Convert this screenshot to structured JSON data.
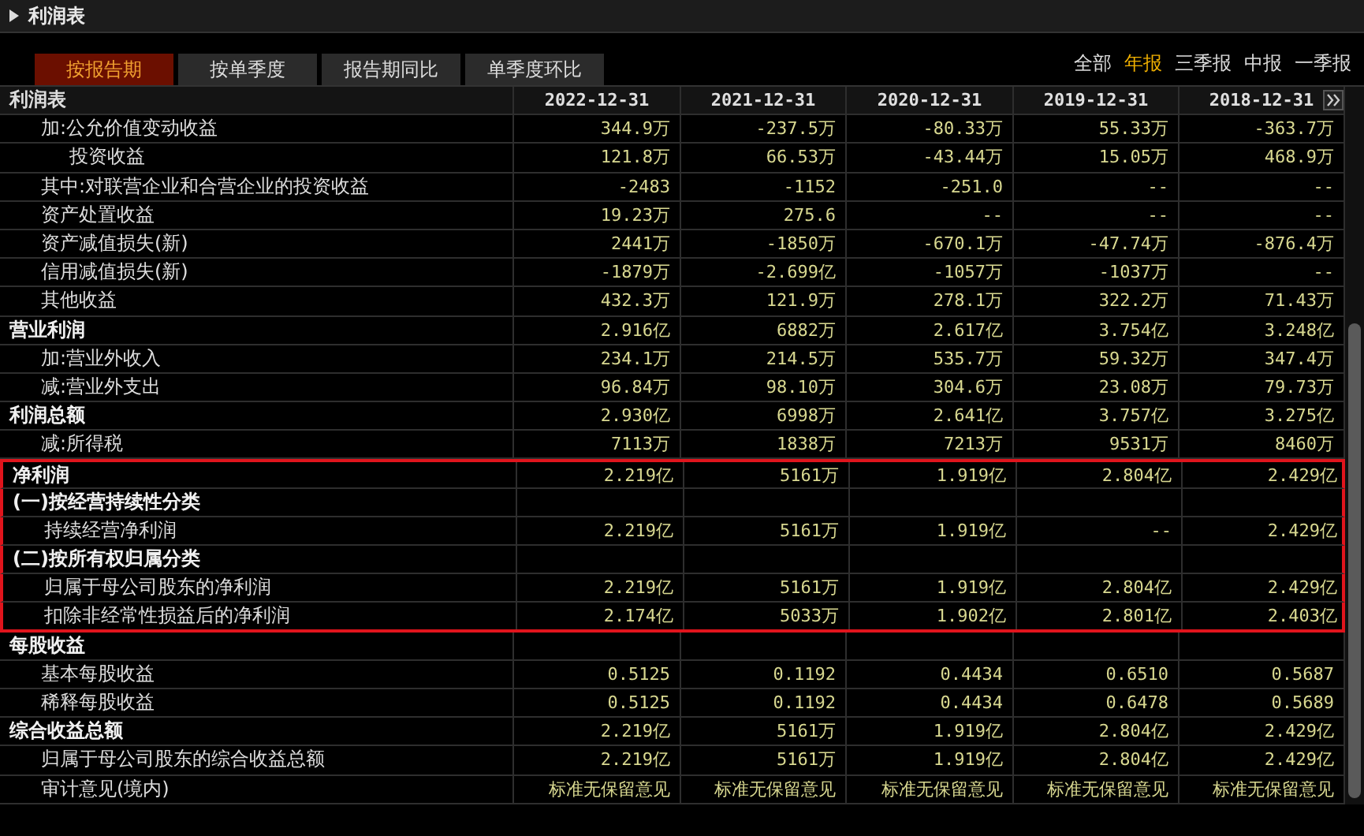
{
  "panel": {
    "title": "利润表"
  },
  "tabs": [
    {
      "label": "按报告期",
      "selected": true
    },
    {
      "label": "按单季度",
      "selected": false
    },
    {
      "label": "报告期同比",
      "selected": false
    },
    {
      "label": "单季度环比",
      "selected": false
    }
  ],
  "period_filters": [
    {
      "label": "全部",
      "selected": false
    },
    {
      "label": "年报",
      "selected": true
    },
    {
      "label": "三季报",
      "selected": false
    },
    {
      "label": "中报",
      "selected": false
    },
    {
      "label": "一季报",
      "selected": false
    }
  ],
  "table": {
    "columns": [
      "利润表",
      "2022-12-31",
      "2021-12-31",
      "2020-12-31",
      "2019-12-31",
      "2018-12-31"
    ],
    "rows": [
      {
        "label": "加:公允价值变动收益",
        "kind": "item",
        "highlighted": false,
        "values": [
          "344.9万",
          "-237.5万",
          "-80.33万",
          "55.33万",
          "-363.7万"
        ]
      },
      {
        "label": "投资收益",
        "kind": "subitem",
        "highlighted": false,
        "values": [
          "121.8万",
          "66.53万",
          "-43.44万",
          "15.05万",
          "468.9万"
        ]
      },
      {
        "label": "其中:对联营企业和合营企业的投资收益",
        "kind": "item",
        "highlighted": false,
        "values": [
          "-2483",
          "-1152",
          "-251.0",
          "--",
          "--"
        ]
      },
      {
        "label": "资产处置收益",
        "kind": "item",
        "highlighted": false,
        "values": [
          "19.23万",
          "275.6",
          "--",
          "--",
          "--"
        ]
      },
      {
        "label": "资产减值损失(新)",
        "kind": "item",
        "highlighted": false,
        "values": [
          "2441万",
          "-1850万",
          "-670.1万",
          "-47.74万",
          "-876.4万"
        ]
      },
      {
        "label": "信用减值损失(新)",
        "kind": "item",
        "highlighted": false,
        "values": [
          "-1879万",
          "-2.699亿",
          "-1057万",
          "-1037万",
          "--"
        ]
      },
      {
        "label": "其他收益",
        "kind": "item",
        "highlighted": false,
        "values": [
          "432.3万",
          "121.9万",
          "278.1万",
          "322.2万",
          "71.43万"
        ]
      },
      {
        "label": "营业利润",
        "kind": "section",
        "highlighted": false,
        "values": [
          "2.916亿",
          "6882万",
          "2.617亿",
          "3.754亿",
          "3.248亿"
        ]
      },
      {
        "label": "加:营业外收入",
        "kind": "item",
        "highlighted": false,
        "values": [
          "234.1万",
          "214.5万",
          "535.7万",
          "59.32万",
          "347.4万"
        ]
      },
      {
        "label": "减:营业外支出",
        "kind": "item",
        "highlighted": false,
        "values": [
          "96.84万",
          "98.10万",
          "304.6万",
          "23.08万",
          "79.73万"
        ]
      },
      {
        "label": "利润总额",
        "kind": "section",
        "highlighted": false,
        "values": [
          "2.930亿",
          "6998万",
          "2.641亿",
          "3.757亿",
          "3.275亿"
        ]
      },
      {
        "label": "减:所得税",
        "kind": "item",
        "highlighted": false,
        "values": [
          "7113万",
          "1838万",
          "7213万",
          "9531万",
          "8460万"
        ]
      },
      {
        "label": "净利润",
        "kind": "section",
        "highlighted": true,
        "values": [
          "2.219亿",
          "5161万",
          "1.919亿",
          "2.804亿",
          "2.429亿"
        ]
      },
      {
        "label": "(一)按经营持续性分类",
        "kind": "section",
        "highlighted": true,
        "values": []
      },
      {
        "label": "持续经营净利润",
        "kind": "item",
        "highlighted": true,
        "values": [
          "2.219亿",
          "5161万",
          "1.919亿",
          "--",
          "2.429亿"
        ]
      },
      {
        "label": "(二)按所有权归属分类",
        "kind": "section",
        "highlighted": true,
        "values": []
      },
      {
        "label": "归属于母公司股东的净利润",
        "kind": "item",
        "highlighted": true,
        "values": [
          "2.219亿",
          "5161万",
          "1.919亿",
          "2.804亿",
          "2.429亿"
        ]
      },
      {
        "label": "扣除非经常性损益后的净利润",
        "kind": "item",
        "highlighted": true,
        "values": [
          "2.174亿",
          "5033万",
          "1.902亿",
          "2.801亿",
          "2.403亿"
        ]
      },
      {
        "label": "每股收益",
        "kind": "section",
        "highlighted": false,
        "values": []
      },
      {
        "label": "基本每股收益",
        "kind": "item",
        "highlighted": false,
        "values": [
          "0.5125",
          "0.1192",
          "0.4434",
          "0.6510",
          "0.5687"
        ]
      },
      {
        "label": "稀释每股收益",
        "kind": "item",
        "highlighted": false,
        "values": [
          "0.5125",
          "0.1192",
          "0.4434",
          "0.6478",
          "0.5689"
        ]
      },
      {
        "label": "综合收益总额",
        "kind": "section",
        "highlighted": false,
        "values": [
          "2.219亿",
          "5161万",
          "1.919亿",
          "2.804亿",
          "2.429亿"
        ]
      },
      {
        "label": "归属于母公司股东的综合收益总额",
        "kind": "item",
        "highlighted": false,
        "values": [
          "2.219亿",
          "5161万",
          "1.919亿",
          "2.804亿",
          "2.429亿"
        ]
      },
      {
        "label": "审计意见(境内)",
        "kind": "item",
        "highlighted": false,
        "values": [
          "标准无保留意见",
          "标准无保留意见",
          "标准无保留意见",
          "标准无保留意见",
          "标准无保留意见"
        ]
      }
    ]
  }
}
